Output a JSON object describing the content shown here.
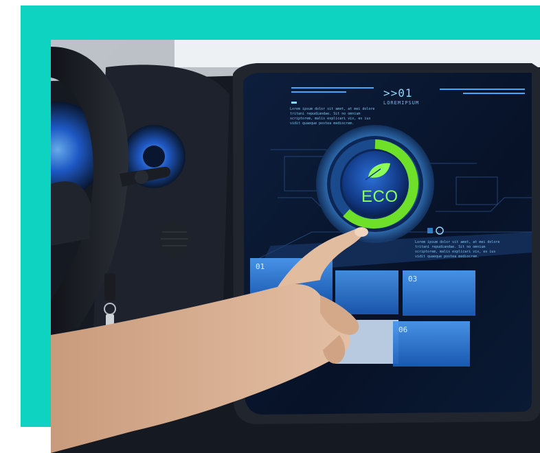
{
  "hud": {
    "header_title": ">>01",
    "header_subtitle": "LOREMIPSUM",
    "note_top": "Lorem ipsum dolor sit amet, at mei dolore tritani repudiandae. Sit no omnium scriptorem, malis explicari vix, ex ius vidit quaeque postea mediocrem.",
    "note_right": "Lorem ipsum dolor sit amet, at mei dolore tritani repudiandae. Sit no omnium scriptorem, malis explicari vix, ex ius vidit quaeque postea mediocrem."
  },
  "eco_button": {
    "label": "ECO",
    "icon": "leaf-icon",
    "progress": 0.72,
    "ring_color": "#6fe02a"
  },
  "tiles": [
    {
      "label": "01"
    },
    {
      "label": "03"
    },
    {
      "label": "06"
    }
  ],
  "colors": {
    "frame_accent": "#0fd3c1",
    "screen_glow": "#3fa8ff"
  }
}
